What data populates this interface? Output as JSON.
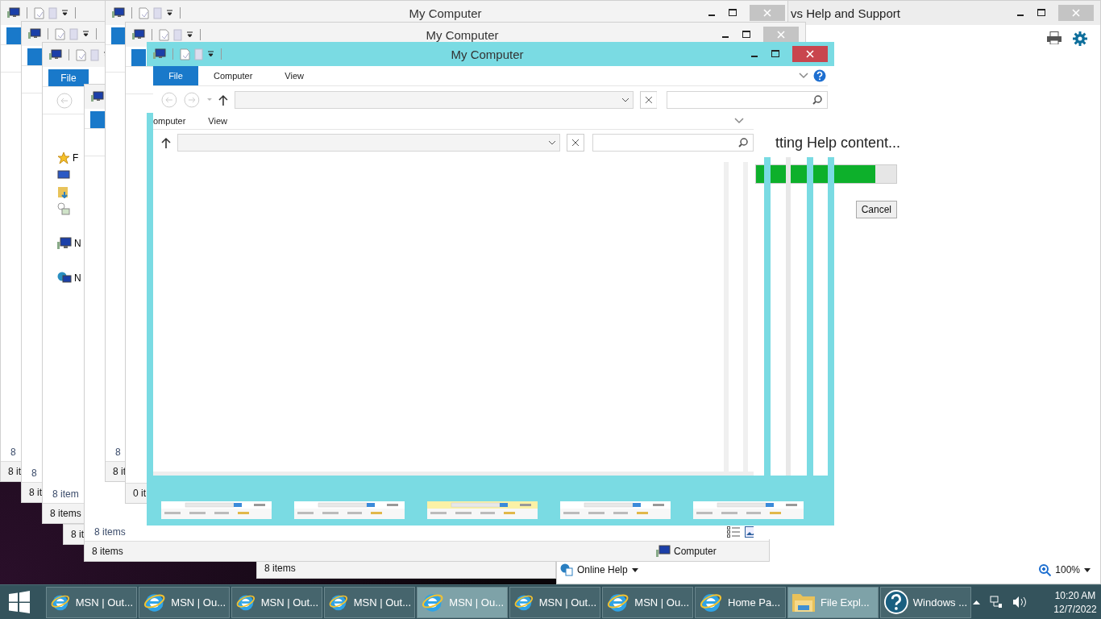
{
  "help_window": {
    "title": "vs Help and Support",
    "loading_text": "tting Help content...",
    "progress": {
      "level": 0.85
    },
    "cancel_button": "Cancel",
    "online_help": "Online Help",
    "zoom": "100%"
  },
  "background_windows": [
    {
      "status": "8 it",
      "item_count": "8"
    },
    {
      "title": "My Computer",
      "status": "8 it",
      "item_count": "8"
    },
    {
      "status": "8 it",
      "item_count": "8"
    },
    {
      "title": "My Computer",
      "status": "0 it"
    },
    {
      "status": "8 items",
      "item_count": "8 item",
      "file_tab": "File",
      "nav_items": [
        {
          "kind": "star",
          "label": "F"
        },
        {
          "kind": "desktop"
        },
        {
          "kind": "folder"
        },
        {
          "kind": "homegroup"
        },
        {
          "kind": "computer",
          "label": "N"
        },
        {
          "kind": "network",
          "label": "N"
        }
      ]
    },
    {
      "status": "8 it"
    },
    {
      "status": "8 items",
      "item_count": "8 items",
      "status_right": "Computer",
      "view_buttons": true
    },
    {
      "status": "8 items"
    }
  ],
  "main_window": {
    "title": "My Computer",
    "tabs": [
      {
        "label": "File",
        "selected": true
      },
      {
        "label": "Computer",
        "selected": false
      },
      {
        "label": "View",
        "selected": false
      }
    ],
    "ghost_tabs": [
      "omputer",
      "View"
    ],
    "thumbnails": [
      {
        "kind": "picture"
      },
      {
        "kind": "picture"
      },
      {
        "kind": "picture"
      },
      {
        "kind": "picture"
      },
      {
        "kind": "picture"
      }
    ]
  },
  "taskbar": {
    "buttons": [
      {
        "kind": "browser",
        "label": "MSN | Out...",
        "active": false
      },
      {
        "kind": "browser",
        "label": "MSN | Ou...",
        "active": false
      },
      {
        "kind": "browser",
        "label": "MSN | Out...",
        "active": false
      },
      {
        "kind": "browser",
        "label": "MSN | Out...",
        "active": false
      },
      {
        "kind": "browser",
        "label": "MSN | Ou...",
        "active": true
      },
      {
        "kind": "browser",
        "label": "MSN | Out...",
        "active": false
      },
      {
        "kind": "browser",
        "label": "MSN | Ou...",
        "active": false
      },
      {
        "kind": "browser",
        "label": "Home Pa...",
        "active": false
      },
      {
        "kind": "folder",
        "label": "File Expl...",
        "active": true
      },
      {
        "kind": "help",
        "label": "Windows ...",
        "active": false
      }
    ],
    "time": "10:20 AM",
    "date": "12/7/2022"
  }
}
